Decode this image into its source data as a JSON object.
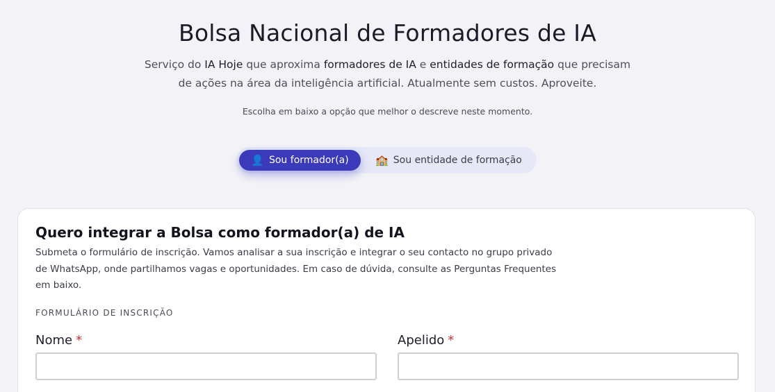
{
  "header": {
    "title": "Bolsa Nacional de Formadores de IA",
    "intro_1": "Serviço do ",
    "intro_brand": "IA Hoje",
    "intro_2": " que aproxima ",
    "intro_trainers": "formadores de IA",
    "intro_3": " e ",
    "intro_entities": "entidades de formação",
    "intro_4": " que precisam de ações na área da inteligência artificial. Atualmente sem custos. Aproveite.",
    "hint": "Escolha em baixo a opção que melhor o descreve neste momento."
  },
  "toggle": {
    "options": [
      {
        "icon": "👤",
        "label": "Sou formador(a)",
        "active": true
      },
      {
        "icon": "🏫",
        "label": "Sou entidade de formação",
        "active": false
      }
    ]
  },
  "card": {
    "title": "Quero integrar a Bolsa como formador(a) de IA",
    "description": "Submeta o formulário de inscrição. Vamos analisar a sua inscrição e integrar o seu contacto no grupo privado de WhatsApp, onde partilhamos vagas e oportunidades. Em caso de dúvida, consulte as Perguntas Frequentes em baixo.",
    "section_label": "FORMULÁRIO DE INSCRIÇÃO",
    "fields": [
      {
        "label": "Nome",
        "required_mark": "*",
        "value": ""
      },
      {
        "label": "Apelido",
        "required_mark": "*",
        "value": ""
      }
    ]
  },
  "colors": {
    "accent": "#3a3aba",
    "required": "#c0303a",
    "background": "#f3f3f7"
  }
}
